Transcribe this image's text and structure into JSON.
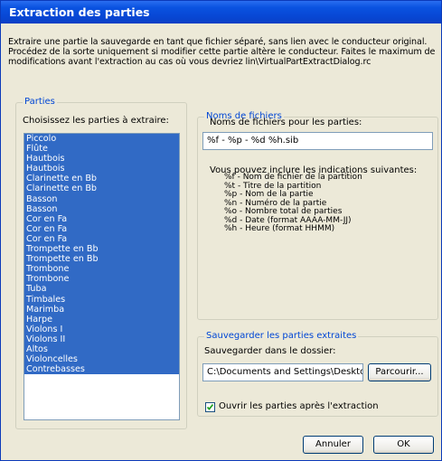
{
  "window": {
    "title": "Extraction des parties"
  },
  "intro_text": "Extraire une partie la sauvegarde en tant que fichier séparé, sans lien avec le conducteur original. Procédez de la sorte uniquement si modifier cette partie altère le conducteur. Faites le maximum de modifications avant l'extraction au cas où vous devriez lin\\VirtualPartExtractDialog.rc",
  "parts_group": {
    "title": "Parties",
    "label": "Choisissez les parties à extraire:",
    "items": [
      "Piccolo",
      "Flûte",
      "Hautbois",
      "Hautbois",
      "Clarinette en Bb",
      "Clarinette en Bb",
      "Basson",
      "Basson",
      "Cor en Fa",
      "Cor en Fa",
      "Cor en Fa",
      "Trompette en Bb",
      "Trompette en Bb",
      "Trombone",
      "Trombone",
      "Tuba",
      "Timbales",
      "Marimba",
      "Harpe",
      "Violons I",
      "Violons II",
      "Altos",
      "Violoncelles",
      "Contrebasses"
    ],
    "selection_color": "#316ac5"
  },
  "filenames_group": {
    "title": "Noms de fichiers",
    "label": "Noms de fichiers pour les parties:",
    "value": "%f - %p - %d %h.sib",
    "hints_label": "Vous pouvez inclure les indications suivantes:",
    "hints": [
      "%f - Nom de fichier de la partition",
      "%t - Titre de la partition",
      "%p - Nom de la partie",
      "%n - Numéro de la partie",
      "%o - Nombre total de parties",
      "%d - Date (format AAAA-MM-JJ)",
      "%h - Heure (format HHMM)"
    ]
  },
  "save_group": {
    "title": "Sauvegarder les parties extraites",
    "folder_label": "Sauvegarder dans le dossier:",
    "folder_value": "C:\\Documents and Settings\\Desktop\\",
    "browse_label": "Parcourir...",
    "open_after_label": "Ouvrir les parties après l'extraction",
    "open_after_checked": true
  },
  "buttons": {
    "cancel": "Annuler",
    "ok": "OK"
  },
  "colors": {
    "titlebar": "#0a52e0",
    "group_title": "#0046d5",
    "face": "#ece9d8"
  }
}
